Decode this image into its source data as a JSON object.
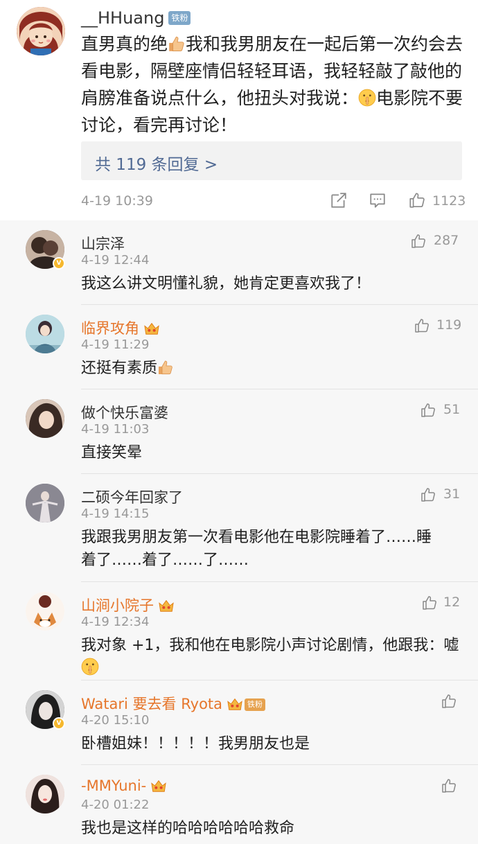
{
  "colors": {
    "vip_name": "#e6762b",
    "link": "#516a94",
    "meta": "#999999",
    "background": "#f7f7f7"
  },
  "main_post": {
    "username": "__HHuang",
    "fan_badge": "铁粉",
    "text_1": "直男真的绝",
    "text_2": "我和我男朋友在一起后第一次约会去看电影，隔壁座情侣轻轻耳语，我轻轻敲了敲他的肩膀准备说点什么，他扭头对我说：",
    "text_3": "电影院不要讨论，看完再讨论！",
    "emoji_1": "thumbs-up-icon",
    "emoji_2": "shush-icon",
    "reply_link": "共 119 条回复 >",
    "timestamp": "4-19 10:39",
    "like_count": "1123",
    "icons": [
      "share-icon",
      "comment-icon",
      "like-icon"
    ]
  },
  "comments": [
    {
      "username": "山宗泽",
      "time": "4-19 12:44",
      "text": "我这么讲文明懂礼貌，她肯定更喜欢我了！",
      "likes": "287"
    },
    {
      "username": "临界攻角",
      "time": "4-19 11:29",
      "text": "还挺有素质",
      "likes": "119"
    },
    {
      "username": "做个快乐富婆",
      "time": "4-19 11:03",
      "text": "直接笑晕",
      "likes": "51"
    },
    {
      "username": "二硕今年回家了",
      "time": "4-19 14:15",
      "text": "我跟我男朋友第一次看电影他在电影院睡着了……睡着了……着了……了……",
      "likes": "31"
    },
    {
      "username": "山涧小院子",
      "time": "4-19 12:34",
      "text": "我对象 +1，我和他在电影院小声讨论剧情，他跟我：嘘",
      "likes": "12"
    },
    {
      "username": "Watari 要去看 Ryota",
      "time": "4-20 15:10",
      "text": "卧槽姐妹！！！！！我男朋友也是",
      "likes": "",
      "fan_badge": "铁粉"
    },
    {
      "username": "-MMYuni-",
      "time": "4-20 01:22",
      "text": "我也是这样的哈哈哈哈哈哈救命",
      "likes": ""
    }
  ]
}
